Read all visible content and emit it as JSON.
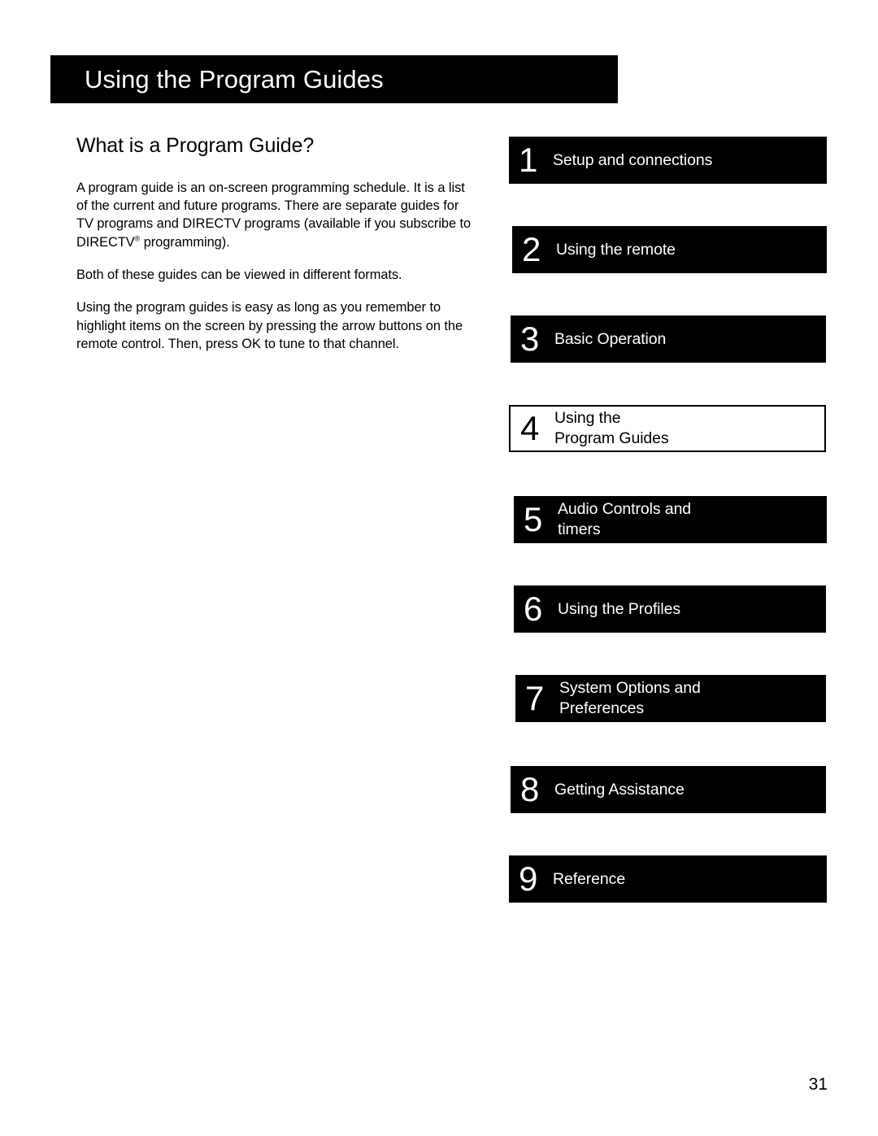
{
  "page": {
    "title": "Using the Program Guides",
    "number": "31"
  },
  "content": {
    "heading": "What is a Program Guide?",
    "paragraphs": [
      {
        "before_mark": "A program guide is an on-screen programming schedule. It is a list of the current and future programs. There are separate guides for TV programs and DIRECTV programs (available if you subscribe to DIRECTV",
        "mark": "®",
        "after_mark": " programming)."
      },
      {
        "text": "Both of these guides can be viewed in different formats."
      },
      {
        "text": "Using the program guides is easy as long as you remember to highlight items on the screen by pressing the arrow buttons on the remote control. Then, press OK to tune to that channel."
      }
    ]
  },
  "chapters": [
    {
      "number": "1",
      "label": "Setup and connections",
      "current": false
    },
    {
      "number": "2",
      "label": "Using the remote",
      "current": false
    },
    {
      "number": "3",
      "label": "Basic Operation",
      "current": false
    },
    {
      "number": "4",
      "label": "Using the\nProgram Guides",
      "current": true
    },
    {
      "number": "5",
      "label": "Audio Controls and\ntimers",
      "current": false
    },
    {
      "number": "6",
      "label": "Using the Profiles",
      "current": false
    },
    {
      "number": "7",
      "label": "System Options and\nPreferences",
      "current": false
    },
    {
      "number": "8",
      "label": "Getting Assistance",
      "current": false
    },
    {
      "number": "9",
      "label": "Reference",
      "current": false
    }
  ],
  "colors": {
    "banner_background": "#000000",
    "banner_text": "#ffffff",
    "page_background": "#ffffff",
    "body_text": "#000000"
  }
}
